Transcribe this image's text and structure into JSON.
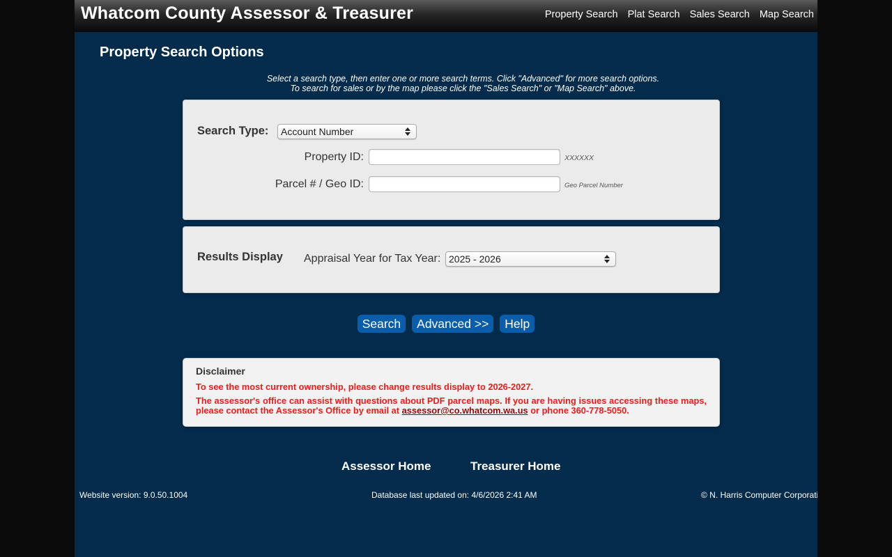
{
  "header": {
    "site_title": "Whatcom County Assessor & Treasurer",
    "nav": [
      "Property Search",
      "Plat Search",
      "Sales Search",
      "Map Search"
    ]
  },
  "page_title": "Property Search Options",
  "instructions": {
    "line1": "Select a search type, then enter one or more search terms. Click \"Advanced\" for more search options.",
    "line2": "To search for sales or by the map please click the \"Sales Search\" or \"Map Search\" above."
  },
  "search_panel": {
    "search_type_label": "Search Type:",
    "search_type_value": "Account Number",
    "property_id_label": "Property ID:",
    "property_id_value": "",
    "property_id_hint": "XXXXXX",
    "parcel_label": "Parcel # / Geo ID:",
    "parcel_value": "",
    "parcel_hint": "Geo Parcel Number"
  },
  "results_panel": {
    "title": "Results Display",
    "year_label": "Appraisal Year for Tax Year:",
    "year_value": "2025 - 2026"
  },
  "buttons": {
    "search": "Search",
    "advanced": "Advanced >>",
    "help": "Help"
  },
  "disclaimer": {
    "title": "Disclaimer",
    "line1": "To see the most current ownership, please change results display to 2026-2027.",
    "line2_start": "The assessor's office can assist with questions about PDF parcel maps. If you are having issues accessing these maps, please contact the Assessor's Office by email at ",
    "email": "assessor@co.whatcom.wa.us",
    "line2_end": " or phone 360-778-5050."
  },
  "footer": {
    "assessor_home": "Assessor Home",
    "treasurer_home": "Treasurer Home",
    "version": "Website version: 9.0.50.1004",
    "db_updated": "Database last updated on: 4/6/2026 2:41 AM",
    "copyright": "© N. Harris Computer Corporation"
  },
  "colors": {
    "page_bg": "#022b4c",
    "button_bg": "#0a5dab",
    "disclaimer_text": "#ef1b1b"
  }
}
